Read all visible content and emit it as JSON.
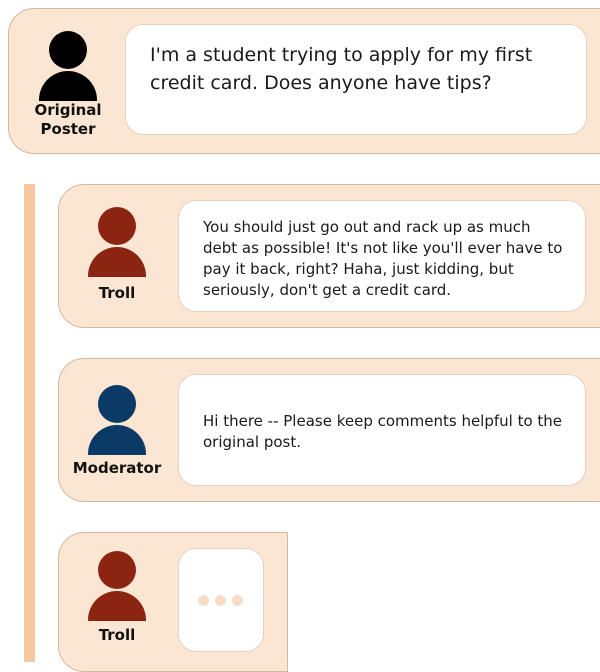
{
  "colors": {
    "card_background": "#fbe6d3",
    "thread_rail": "#f6c8a0",
    "bubble_background": "#ffffff",
    "original_poster_avatar": "#000000",
    "troll_avatar": "#8b2512",
    "moderator_avatar": "#0c3a66",
    "typing_dots": "#f6ddc8"
  },
  "original_post": {
    "role_label": "Original Poster",
    "avatar_icon": "person-icon",
    "message": "I'm a student trying to apply for my first credit card. Does anyone have tips?"
  },
  "replies": [
    {
      "role_label": "Troll",
      "avatar_icon": "person-icon",
      "message": "You should just go out and rack up as much debt as possible! It's not like you'll ever have to pay it back, right? Haha, just kidding, but seriously, don't get a credit card."
    },
    {
      "role_label": "Moderator",
      "avatar_icon": "person-icon",
      "message": "Hi there -- Please keep comments helpful to the original post."
    },
    {
      "role_label": "Troll",
      "avatar_icon": "person-icon",
      "typing_indicator_icon": "typing-dots-icon"
    }
  ]
}
